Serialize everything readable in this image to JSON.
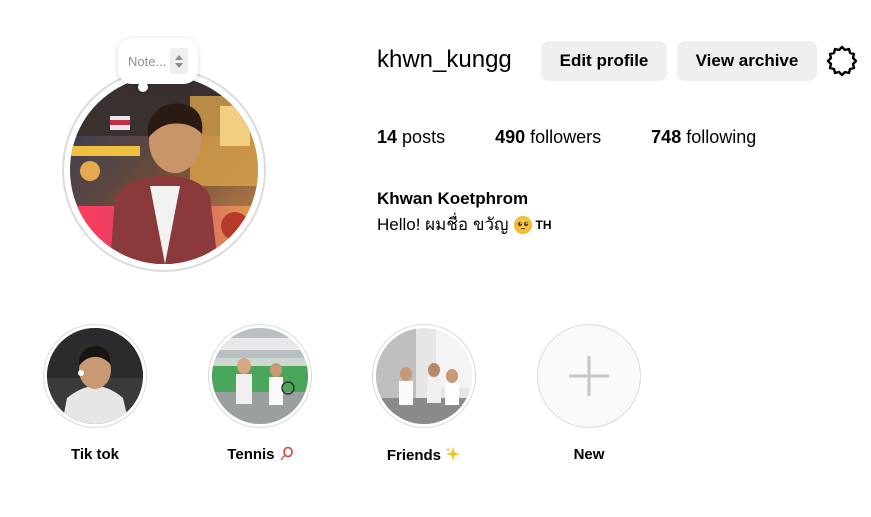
{
  "profile": {
    "username": "khwn_kungg",
    "full_name": "Khwan Koetphrom",
    "bio_text": "Hello! ผมชื่อ ขวัญ",
    "bio_emoji": "pleading-face-emoji",
    "bio_flag": "TH",
    "note_placeholder": "Note..."
  },
  "actions": {
    "edit_profile": "Edit profile",
    "view_archive": "View archive",
    "settings_icon": "gear-icon"
  },
  "stats": {
    "posts_count": "14",
    "posts_label": "posts",
    "followers_count": "490",
    "followers_label": "followers",
    "following_count": "748",
    "following_label": "following"
  },
  "highlights": [
    {
      "label": "Tik tok",
      "emoji": ""
    },
    {
      "label": "Tennis",
      "emoji": "tennis-racket-emoji"
    },
    {
      "label": "Friends",
      "emoji": "sparkles-emoji"
    },
    {
      "label": "New",
      "emoji": "plus-icon"
    }
  ]
}
